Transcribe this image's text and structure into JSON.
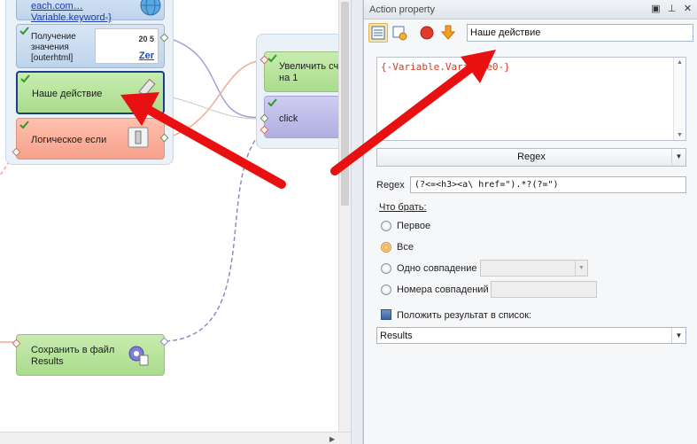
{
  "canvas": {
    "nodes": {
      "foreach_text": "each.com…\nVariable.keyword-}",
      "get_value_text": "Получение\nзначения\n[outerhtml]",
      "get_value_thumb_num": "20 5",
      "get_value_thumb_word": "Zer",
      "our_action_text": "Наше действие",
      "logic_if_text": "Логическое если",
      "increment_text": "Увеличить сч\nна 1",
      "click_text": "click",
      "save_file_text": "Сохранить в файл\nResults"
    }
  },
  "panel": {
    "title": "Action property",
    "title_buttons": {
      "restore": "▣",
      "pin": "⊥",
      "close": "✕"
    },
    "toolbar": {
      "buttons": [
        "properties-icon",
        "macro-icon",
        "stop-icon",
        "down-arrow-icon"
      ]
    },
    "action_name": "Наше действие",
    "code_text": "{-Variable.Variable0-}",
    "mode_select": "Regex",
    "regex_label": "Regex",
    "regex_value": "(?<=<h3><a\\ href=\").*?(?=\")",
    "section_label": "Что брать:",
    "options": [
      {
        "label": "Первое",
        "checked": false
      },
      {
        "label": "Все",
        "checked": true
      },
      {
        "label": "Одно совпадение",
        "checked": false
      },
      {
        "label": "Номера совпадений",
        "checked": false
      }
    ],
    "put_to_list_label": "Положить результат в список:",
    "result_list": "Results"
  },
  "colors": {
    "arrow_red": "#e81010",
    "node_green": "#a9dc8c",
    "node_red": "#f6a18c",
    "node_purple": "#b0aee2",
    "selected_border": "#1c3c8e"
  }
}
